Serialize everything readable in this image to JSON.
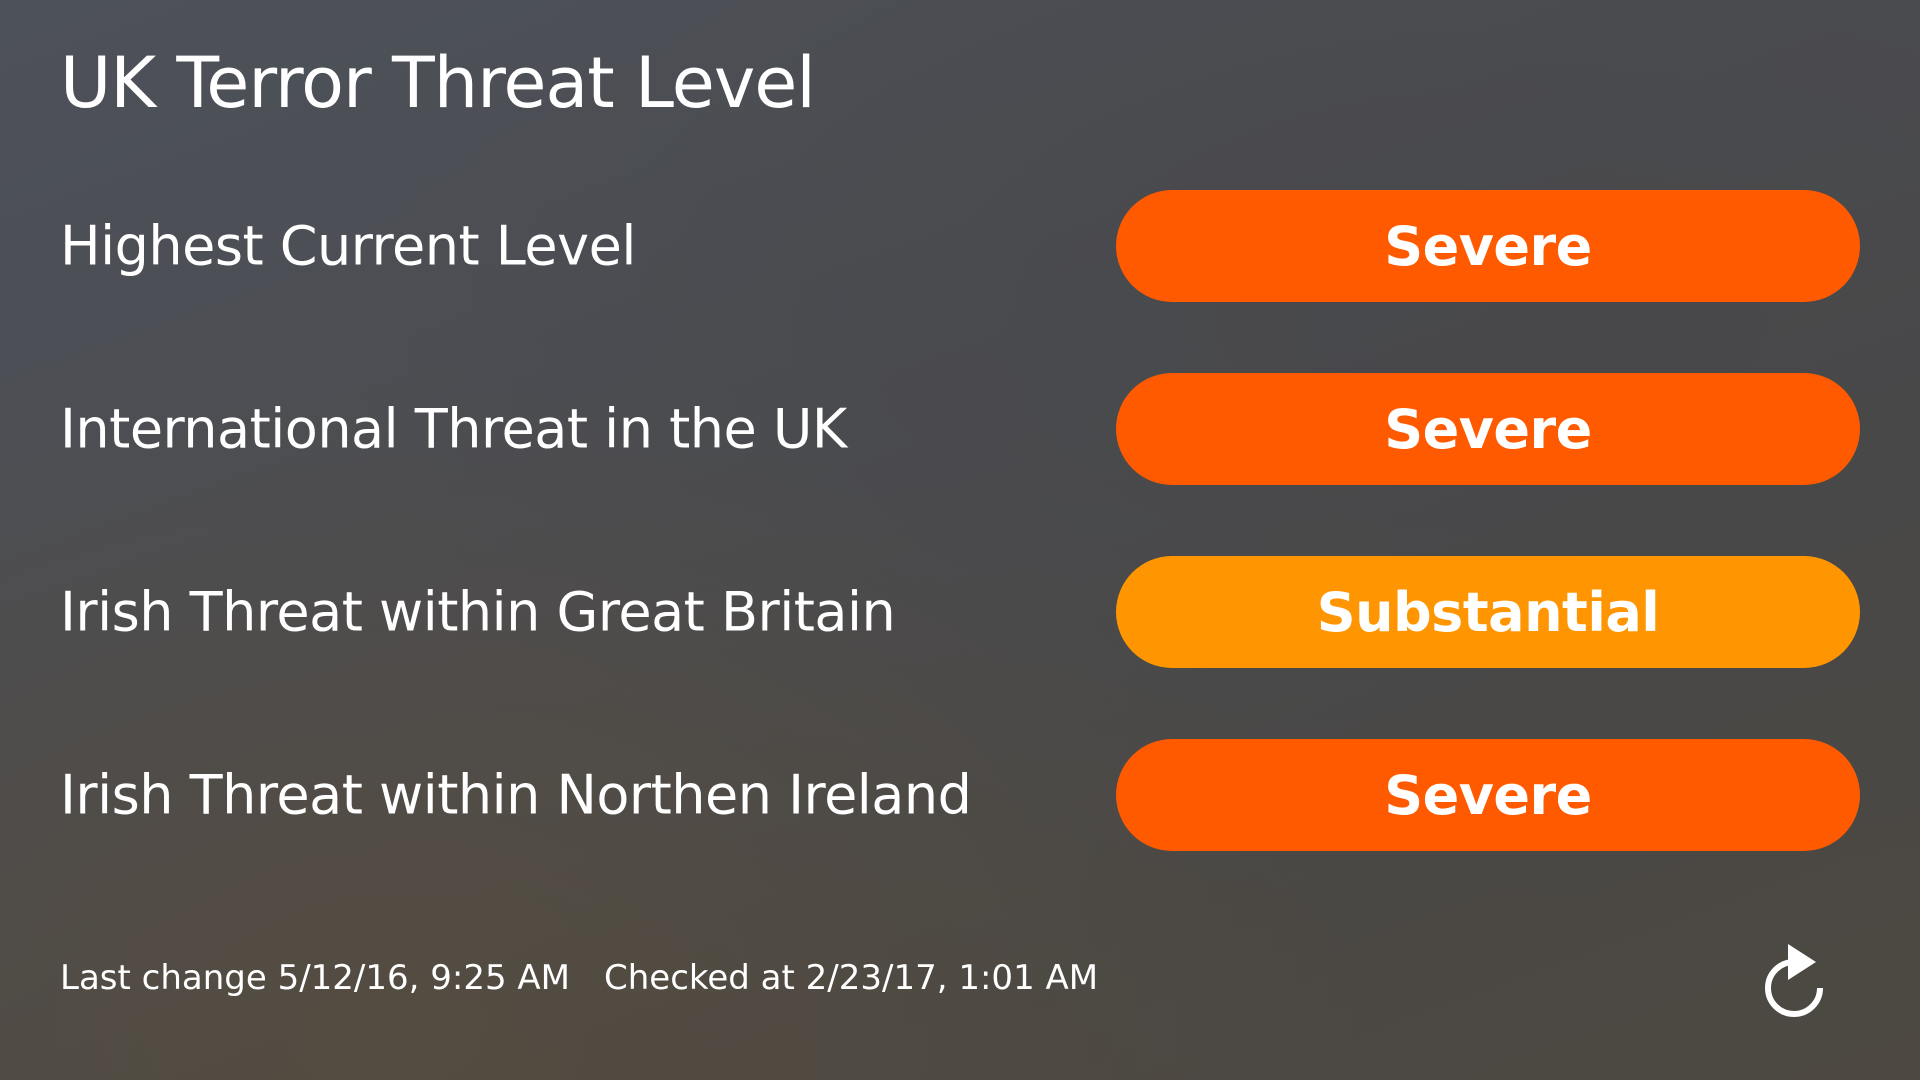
{
  "title": "UK Terror Threat Level",
  "colors": {
    "severe": "#ff5a00",
    "substantial": "#ff9500"
  },
  "rows": [
    {
      "label": "Highest Current Level",
      "level": "Severe",
      "color": "#ff5a00"
    },
    {
      "label": "International Threat in the UK",
      "level": "Severe",
      "color": "#ff5a00"
    },
    {
      "label": "Irish Threat within Great Britain",
      "level": "Substantial",
      "color": "#ff9500"
    },
    {
      "label": "Irish Threat within Northen Ireland",
      "level": "Severe",
      "color": "#ff5a00"
    }
  ],
  "footer": {
    "last_change": "Last change 5/12/16, 9:25 AM",
    "checked_at": "Checked at 2/23/17, 1:01 AM"
  },
  "icons": {
    "refresh": "refresh-icon"
  }
}
